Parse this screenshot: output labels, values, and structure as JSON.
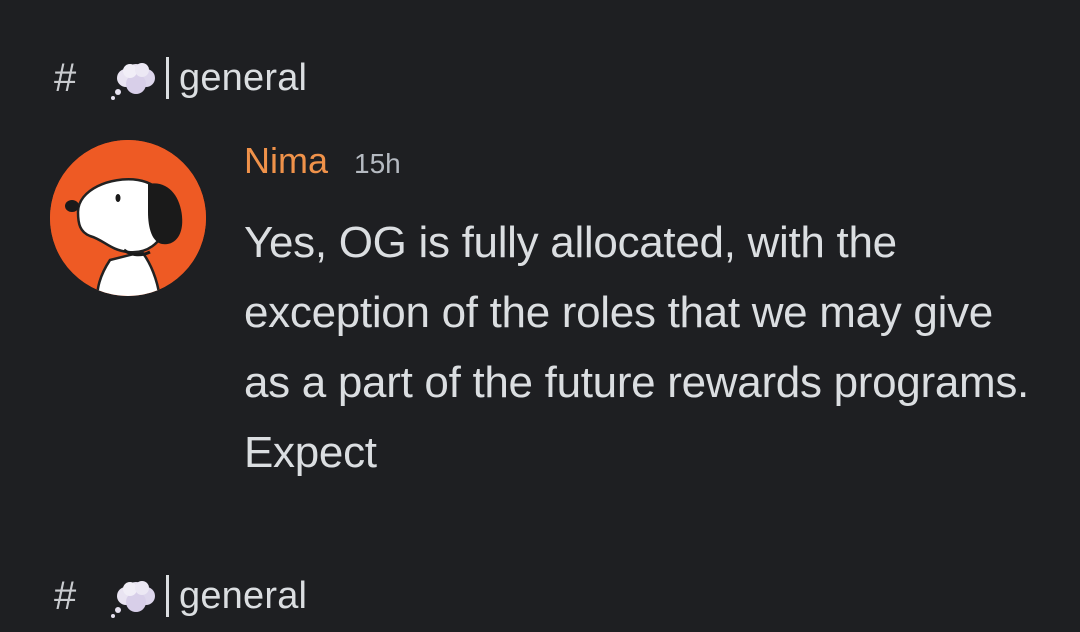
{
  "channel_top": {
    "hash": "#",
    "icon": "thought-bubble-icon",
    "name": "general"
  },
  "message": {
    "author": "Nima",
    "timestamp": "15h",
    "text": "Yes, OG is fully allocated, with the exception of the roles that we may give as a part of the future rewards programs. Expect",
    "author_color": "#f0924a",
    "avatar": "snoopy-avatar"
  },
  "channel_bottom": {
    "hash": "#",
    "icon": "thought-bubble-icon",
    "name": "general"
  }
}
